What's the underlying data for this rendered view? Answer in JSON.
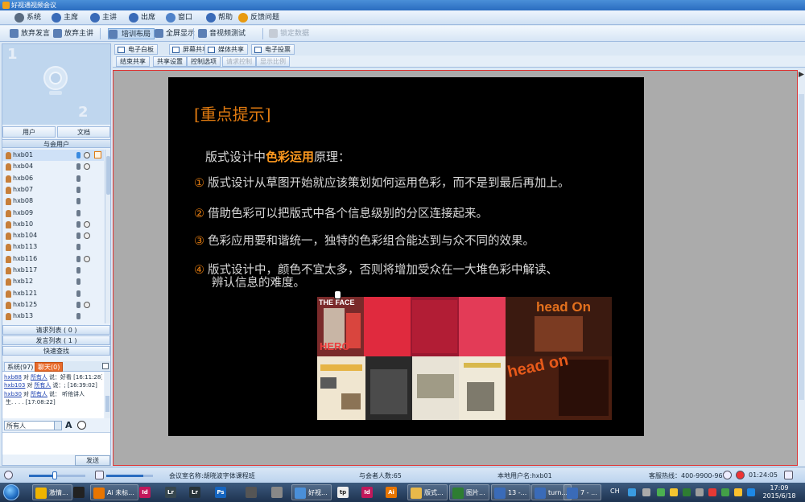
{
  "window": {
    "title": "好视通视频会议"
  },
  "menu": [
    {
      "label": "系统",
      "icon": "gear-icon",
      "color": "#5a6b80"
    },
    {
      "label": "主席",
      "icon": "person-icon",
      "color": "#3a6bb8"
    },
    {
      "label": "主讲",
      "icon": "person-icon",
      "color": "#3a6bb8"
    },
    {
      "label": "出席",
      "icon": "person-icon",
      "color": "#3a6bb8"
    },
    {
      "label": "窗口",
      "icon": "window-icon",
      "color": "#4f82c9"
    },
    {
      "label": "帮助",
      "icon": "info-icon",
      "color": "#3a6bb8"
    },
    {
      "label": "反馈问题",
      "icon": "question-icon",
      "color": "#e89a10"
    }
  ],
  "toolbar": [
    {
      "label": "放弃发言",
      "icon": "speak-icon",
      "state": "normal"
    },
    {
      "label": "放弃主讲",
      "icon": "presenter-icon",
      "state": "normal"
    },
    {
      "label": "培训布局",
      "icon": "layout-icon",
      "state": "active"
    },
    {
      "label": "全屏显示",
      "icon": "fullscreen-icon",
      "state": "normal"
    },
    {
      "label": "音视频测试",
      "icon": "av-test-icon",
      "state": "normal"
    },
    {
      "label": "锁定数据",
      "icon": "lock-icon",
      "state": "disabled"
    }
  ],
  "video": {
    "slot1": "1",
    "slot2": "2"
  },
  "panel_tabs": [
    "用户",
    "文档"
  ],
  "attendees_header": "与会用户",
  "users": [
    {
      "name": "hxb01",
      "mic": "on",
      "cam": true,
      "edit": true
    },
    {
      "name": "hxb04",
      "mic": "off",
      "cam": true,
      "edit": false
    },
    {
      "name": "hxb06",
      "mic": "off",
      "cam": false,
      "edit": false
    },
    {
      "name": "hxb07",
      "mic": "off",
      "cam": false,
      "edit": false
    },
    {
      "name": "hxb08",
      "mic": "off",
      "cam": false,
      "edit": false
    },
    {
      "name": "hxb09",
      "mic": "off",
      "cam": false,
      "edit": false
    },
    {
      "name": "hxb10",
      "mic": "off",
      "cam": true,
      "edit": false
    },
    {
      "name": "hxb104",
      "mic": "off",
      "cam": true,
      "edit": false
    },
    {
      "name": "hxb113",
      "mic": "off",
      "cam": false,
      "edit": false
    },
    {
      "name": "hxb116",
      "mic": "off",
      "cam": true,
      "edit": false
    },
    {
      "name": "hxb117",
      "mic": "off",
      "cam": false,
      "edit": false
    },
    {
      "name": "hxb12",
      "mic": "off",
      "cam": false,
      "edit": false
    },
    {
      "name": "hxb121",
      "mic": "off",
      "cam": false,
      "edit": false
    },
    {
      "name": "hxb125",
      "mic": "off",
      "cam": true,
      "edit": false
    },
    {
      "name": "hxb13",
      "mic": "off",
      "cam": false,
      "edit": false
    }
  ],
  "list_buttons": {
    "request": "请求列表 ( 0 )",
    "speak": "发言列表 ( 1 )",
    "quick_find": "快速查找"
  },
  "chat_tabs": [
    {
      "label": "系统(97)",
      "active": false
    },
    {
      "label": "聊天(0)",
      "active": true
    }
  ],
  "chat": [
    {
      "user": "hxb88",
      "to": "对",
      "target": "所有人",
      "text": "说：好看 [16:11:28]"
    },
    {
      "user": "hxb103",
      "to": "对",
      "target": "所有人",
      "text": "说：; [16:39:02]"
    },
    {
      "user": "hxb30",
      "to": "对",
      "target": "所有人",
      "text": "说： 听他讲人"
    },
    {
      "user": "",
      "to": "",
      "target": "",
      "text": "生. . . .  [17:08:22]"
    }
  ],
  "recipient": "所有人",
  "font_button": "A",
  "send_label": "发送",
  "content_tabs": [
    {
      "label": "电子白板",
      "icon": "whiteboard-icon"
    },
    {
      "label": "屏幕共享",
      "icon": "screen-share-icon"
    },
    {
      "label": "媒体共享",
      "icon": "media-share-icon"
    },
    {
      "label": "电子投票",
      "icon": "vote-icon"
    }
  ],
  "share_buttons": [
    {
      "label": "结束共享",
      "state": "normal"
    },
    {
      "label": "共享设置",
      "state": "normal"
    },
    {
      "label": "控制选项",
      "state": "normal"
    },
    {
      "label": "请求控制",
      "state": "disabled"
    },
    {
      "label": "显示比例",
      "state": "disabled"
    }
  ],
  "slide": {
    "title": "[重点提示]",
    "intro_pre": "版式设计中",
    "intro_hl": "色彩运用",
    "intro_post": "原理：",
    "points": [
      {
        "num": "①",
        "text": "版式设计从草图开始就应该策划如何运用色彩，而不是到最后再加上。"
      },
      {
        "num": "②",
        "text": "借助色彩可以把版式中各个信息级别的分区连接起来。"
      },
      {
        "num": "③",
        "text": "色彩应用要和谐统一，独特的色彩组合能达到与众不同的效果。"
      },
      {
        "num": "④",
        "text": "版式设计中，颜色不宜太多，否则将增加受众在一大堆色彩中解读、"
      },
      {
        "num": "",
        "text": "辨认信息的难度。"
      }
    ],
    "collage_text": {
      "face": "THE FACE",
      "hero": "HERO",
      "head_on_top": "head On",
      "head_on_big": "head on"
    },
    "title_color": "#e07a10",
    "highlight_color": "#ff9a1f"
  },
  "status": {
    "room": "会议室名称:胡晓波字体课程班",
    "count": "与会者人数:65",
    "local_user": "本地用户名:hxb01",
    "hotline": "客服热线：400-9900-967",
    "timer": "01:24:05",
    "volume": 0.45,
    "mic_volume": 0.8
  },
  "taskbar": {
    "pinned": [
      {
        "icon": "browser-icon",
        "label": "",
        "color": "#e44"
      },
      {
        "icon": "chrome-icon",
        "label": "激情...",
        "color": "#f0b400"
      },
      {
        "icon": "qq-icon",
        "label": "",
        "color": "#222"
      },
      {
        "icon": "ai-icon",
        "label": "Ai 未标...",
        "color": "#e87500"
      },
      {
        "icon": "id-icon",
        "label": "Id",
        "color": "#c2185b"
      },
      {
        "icon": "lr-icon",
        "label": "Lr",
        "color": "#37474f"
      },
      {
        "icon": "lr2-icon",
        "label": "Lr",
        "color": "#263238"
      },
      {
        "icon": "ps-icon",
        "label": "Ps",
        "color": "#1565c0"
      },
      {
        "icon": "disc-icon",
        "label": "",
        "color": "#555"
      },
      {
        "icon": "app-icon",
        "label": "",
        "color": "#888"
      },
      {
        "icon": "meeting-icon",
        "label": "好视...",
        "color": "#4a8fd8"
      },
      {
        "icon": "tp-icon",
        "label": "tp",
        "color": "#eee"
      },
      {
        "icon": "id2-icon",
        "label": "Id",
        "color": "#c2185b"
      },
      {
        "icon": "ai2-icon",
        "label": "Ai",
        "color": "#e87500"
      },
      {
        "icon": "folder-icon",
        "label": "版式...",
        "color": "#e8b84a"
      },
      {
        "icon": "pdf-icon",
        "label": "图片...",
        "color": "#2e7d32"
      },
      {
        "icon": "window2-icon",
        "label": "13 -...",
        "color": "#3a6bb8"
      },
      {
        "icon": "window3-icon",
        "label": "turn...",
        "color": "#3a6bb8"
      },
      {
        "icon": "window4-icon",
        "label": "7 - ...",
        "color": "#3a6bb8"
      }
    ],
    "tray_text": "CH",
    "time": "17:09",
    "date": "2015/6/18"
  }
}
